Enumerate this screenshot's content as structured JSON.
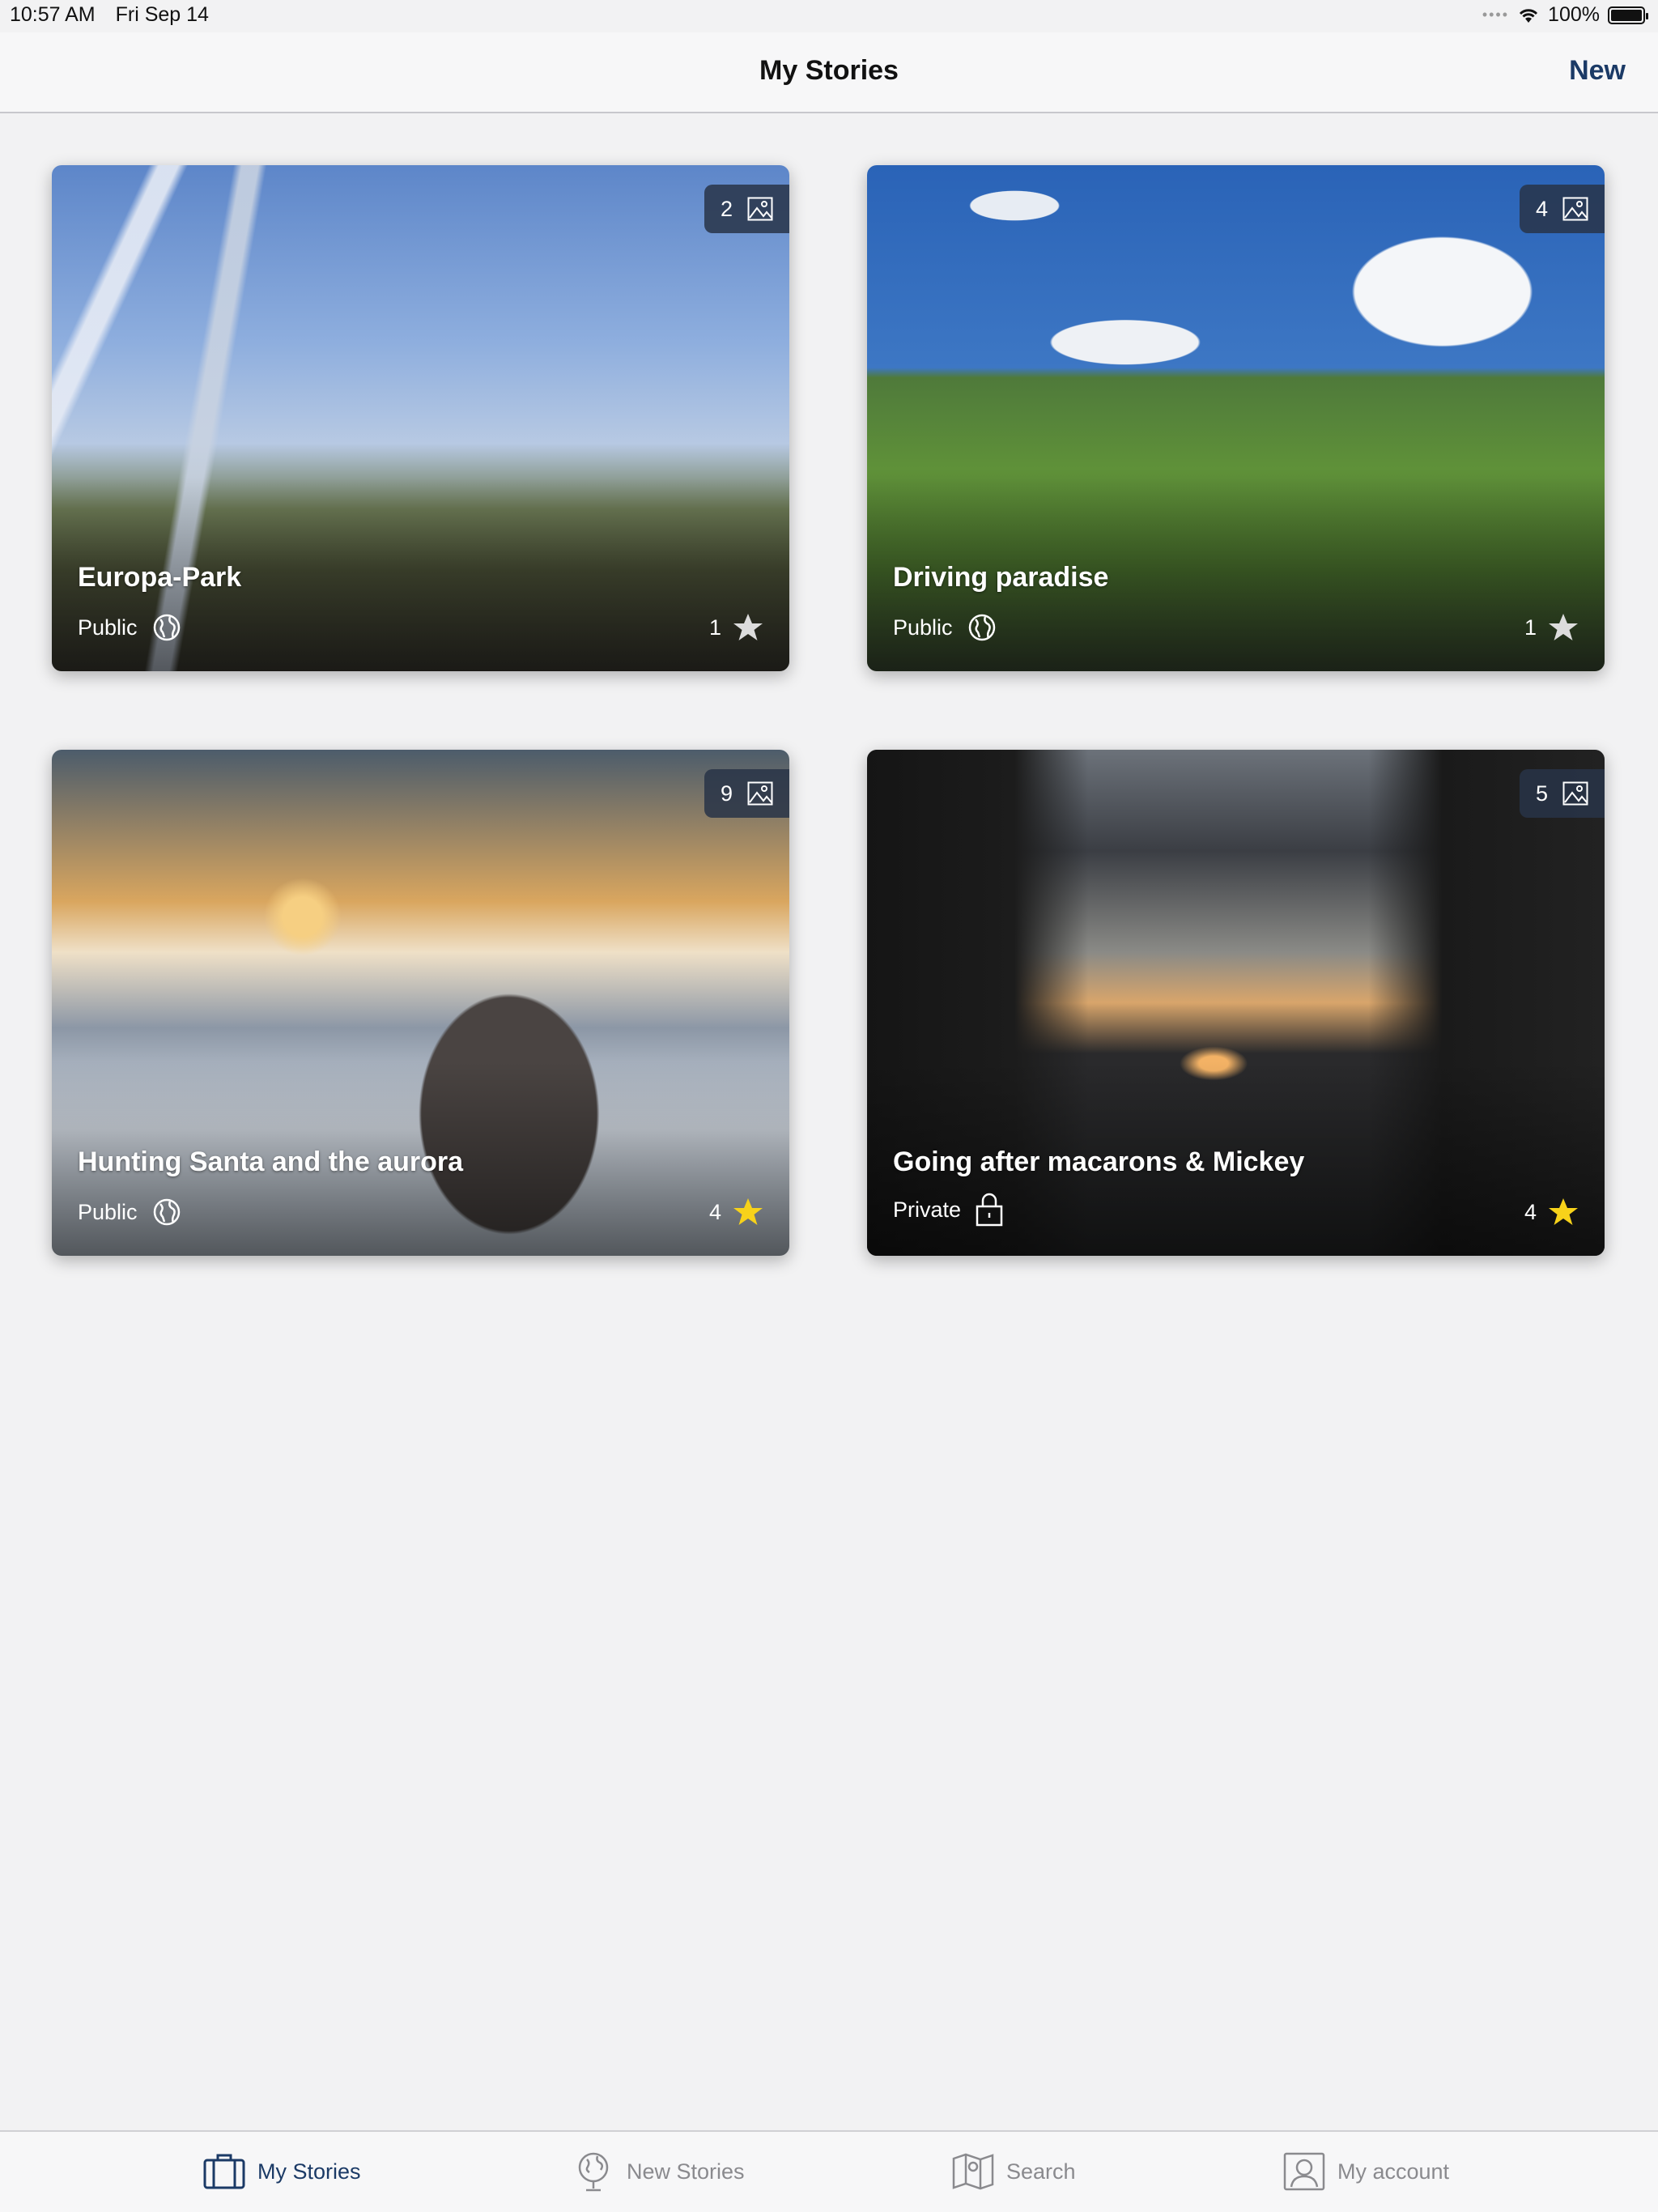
{
  "status_bar": {
    "time": "10:57 AM",
    "date": "Fri Sep 14",
    "battery": "100%"
  },
  "nav": {
    "title": "My Stories",
    "new_label": "New"
  },
  "stories": [
    {
      "title": "Europa-Park",
      "visibility": "Public",
      "photo_count": "2",
      "stars": "1",
      "starred": false
    },
    {
      "title": "Driving paradise",
      "visibility": "Public",
      "photo_count": "4",
      "stars": "1",
      "starred": false
    },
    {
      "title": "Hunting Santa and the aurora",
      "visibility": "Public",
      "photo_count": "9",
      "stars": "4",
      "starred": true
    },
    {
      "title": "Going after macarons & Mickey",
      "visibility": "Private",
      "photo_count": "5",
      "stars": "4",
      "starred": true
    }
  ],
  "tabs": [
    {
      "label": "My Stories",
      "icon": "suitcase-icon",
      "active": true
    },
    {
      "label": "New Stories",
      "icon": "globe-icon",
      "active": false
    },
    {
      "label": "Search",
      "icon": "map-icon",
      "active": false
    },
    {
      "label": "My account",
      "icon": "account-icon",
      "active": false
    }
  ],
  "colors": {
    "accent": "#1b3a66",
    "star_active": "#f7d21a",
    "star_inactive": "#dcdcdc"
  }
}
